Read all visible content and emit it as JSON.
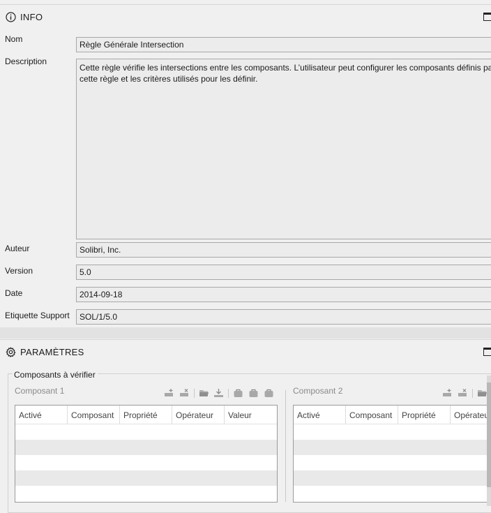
{
  "info": {
    "title": "INFO",
    "fields": {
      "nom": {
        "label": "Nom",
        "value": "Règle Générale Intersection"
      },
      "description": {
        "label": "Description",
        "value": "Cette règle vérifie les intersections entre les composants. L’utilisateur peut configurer les composants définis par cette règle et les critères utilisés pour les définir."
      },
      "auteur": {
        "label": "Auteur",
        "value": "Solibri, Inc."
      },
      "version": {
        "label": "Version",
        "value": "5.0"
      },
      "date": {
        "label": "Date",
        "value": "2014-09-18"
      },
      "etiquette": {
        "label": "Etiquette Support",
        "value": "SOL/1/5.0"
      }
    }
  },
  "parametres": {
    "title": "PARAMÈTRES",
    "group_title": "Composants à vérifier",
    "composant1": {
      "title": "Composant 1",
      "columns": [
        "Activé",
        "Composant",
        "Propriété",
        "Opérateur",
        "Valeur"
      ]
    },
    "composant2": {
      "title": "Composant 2",
      "columns": [
        "Activé",
        "Composant",
        "Propriété",
        "Opérateur"
      ]
    }
  },
  "icons": {
    "info": "info-circle-icon",
    "settings": "gear-icon",
    "window": "window-restore-icon",
    "add_row": "add-row-icon",
    "delete_row": "delete-row-icon",
    "open_folder": "folder-open-icon",
    "import": "import-icon",
    "bag": "bag-icon"
  }
}
